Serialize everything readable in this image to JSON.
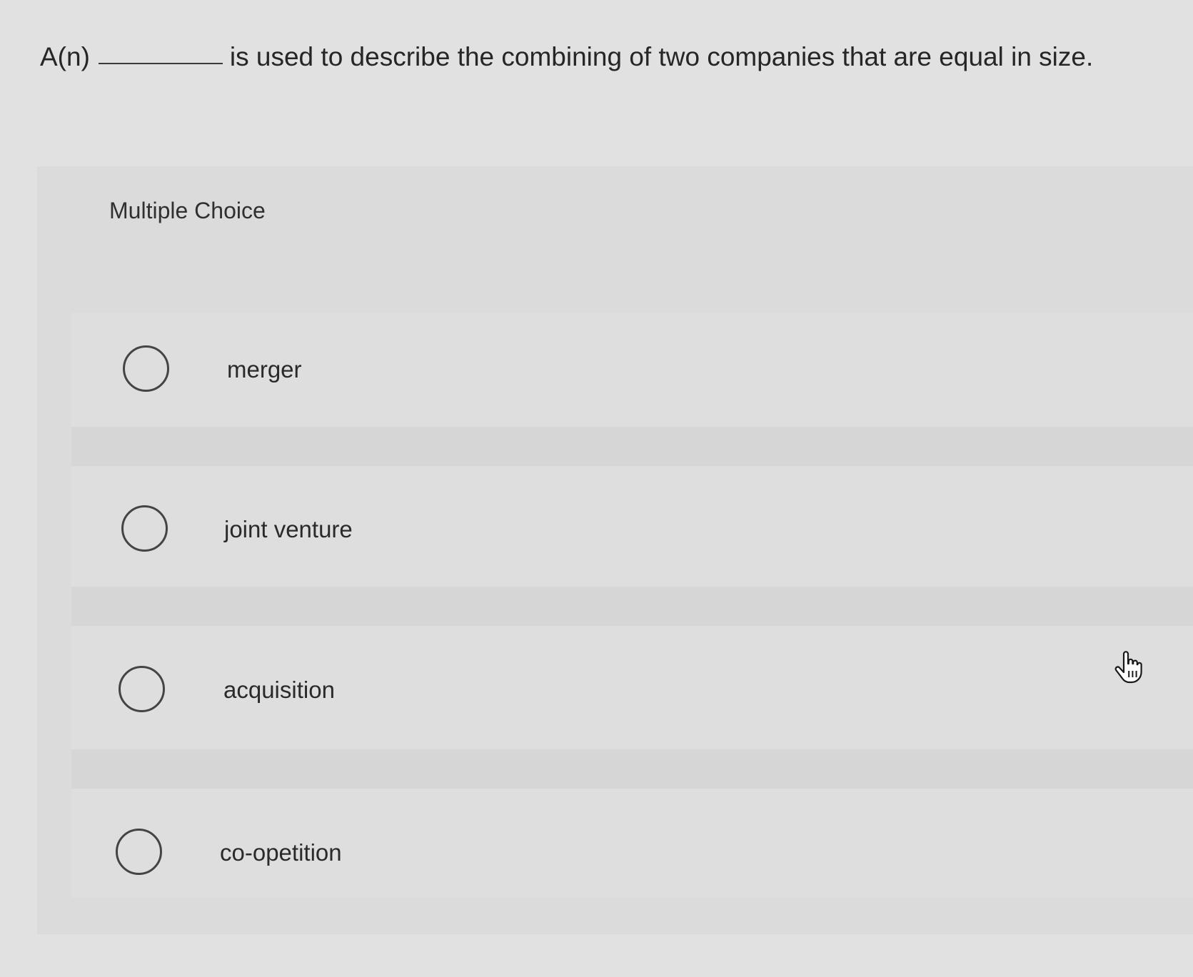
{
  "question": {
    "prefix": "A(n)",
    "suffix": "is used to describe the combining of two companies that are equal in size."
  },
  "section_label": "Multiple Choice",
  "options": [
    {
      "label": "merger",
      "selected": false
    },
    {
      "label": "joint venture",
      "selected": false
    },
    {
      "label": "acquisition",
      "selected": false
    },
    {
      "label": "co-opetition",
      "selected": false
    }
  ],
  "cursor": {
    "icon": "hand-pointer-icon"
  }
}
